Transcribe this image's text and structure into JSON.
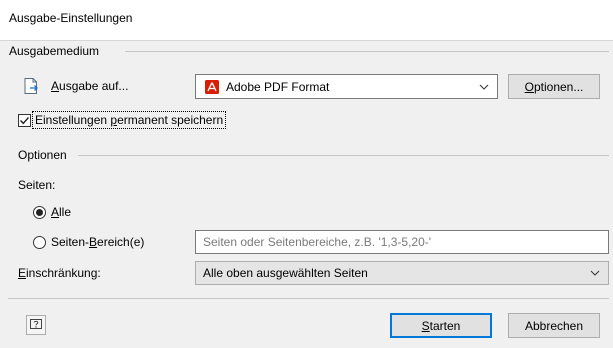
{
  "window": {
    "title": "Ausgabe-Einstellungen"
  },
  "output_group": {
    "title": "Ausgabemedium",
    "output_label_prefix": "A",
    "output_label_rest": "usgabe auf...",
    "format_selected": "Adobe PDF Format",
    "options_button_prefix": "O",
    "options_button_rest": "ptionen...",
    "save_permanent_prefix": "Einstellungen ",
    "save_permanent_underlined": "p",
    "save_permanent_rest": "ermanent speichern",
    "save_permanent_checked": true
  },
  "options_group": {
    "title": "Optionen",
    "pages_label": "Seiten:",
    "radio_all_prefix": "A",
    "radio_all_rest": "lle",
    "radio_all_selected": true,
    "radio_range_prefix": "Seiten-",
    "radio_range_underlined": "B",
    "radio_range_rest": "ereich(e)",
    "radio_range_selected": false,
    "range_placeholder": "Seiten oder Seitenbereiche, z.B. '1,3-5,20-'",
    "restriction_label_prefix": "E",
    "restriction_label_rest": "inschränkung:",
    "restriction_selected": "Alle oben ausgewählten Seiten"
  },
  "footer": {
    "help_icon": "help-icon",
    "start_prefix": "S",
    "start_rest": "tarten",
    "cancel_label": "Abbrechen"
  },
  "colors": {
    "panel_bg": "#f0f0f0",
    "button_bg": "#e1e1e1",
    "default_button_border": "#0078d7",
    "pdf_red": "#d81e05"
  }
}
